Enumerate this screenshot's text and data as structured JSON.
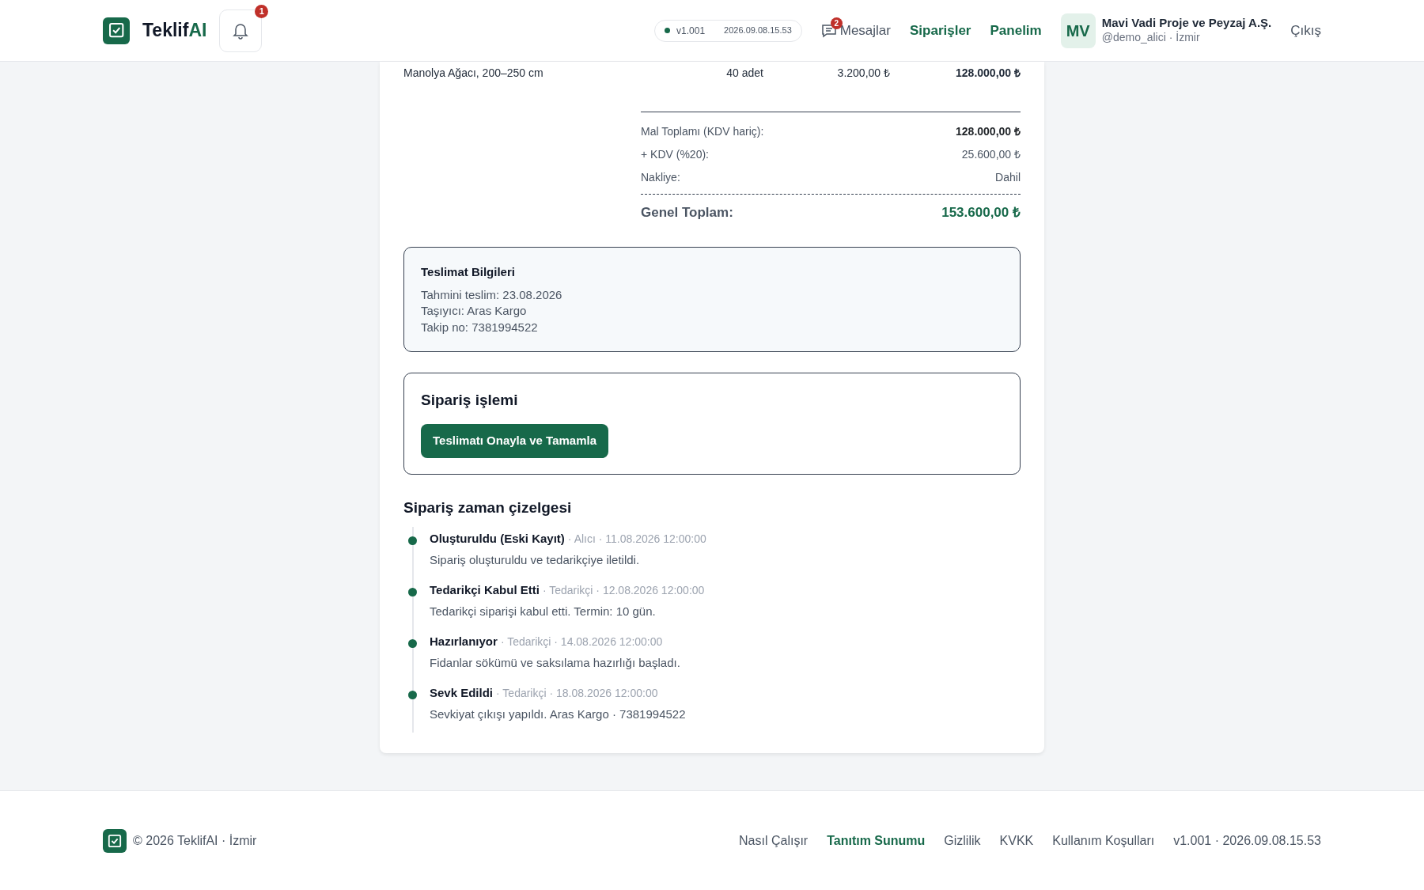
{
  "header": {
    "brand": {
      "name": "Teklif",
      "accent": "AI"
    },
    "notifications": {
      "count": "1"
    },
    "version": {
      "number": "v1.001",
      "build": "2026.09.08.15.53"
    },
    "nav": [
      {
        "label": "Mesajlar",
        "badge": "2",
        "kind": "messages"
      },
      {
        "label": "Siparişler",
        "kind": "primary"
      },
      {
        "label": "Panelim",
        "kind": "primary"
      }
    ],
    "user": {
      "initials": "MV",
      "name": "Mavi Vadi Proje ve Peyzaj A.Ş.",
      "handle": "@demo_alici · İzmir"
    },
    "logout": "Çıkış"
  },
  "order_line": {
    "product": "Manolya Ağacı, 200–250 cm",
    "quantity": "40 adet",
    "unit_price": "3.200,00 ₺",
    "total": "128.000,00 ₺"
  },
  "totals": {
    "rows": [
      {
        "label": "Mal Toplamı (KDV hariç):",
        "value": "128.000,00 ₺",
        "kind": "bold"
      },
      {
        "label": "+ KDV (%20):",
        "value": "25.600,00 ₺",
        "kind": "plain"
      },
      {
        "label": "Nakliye:",
        "value": "Dahil",
        "kind": "plain"
      }
    ],
    "grand_total": {
      "label": "Genel Toplam:",
      "value": "153.600,00 ₺"
    }
  },
  "delivery": {
    "title": "Teslimat Bilgileri",
    "lines": [
      "Tahmini teslim: 23.08.2026",
      "Taşıyıcı: Aras Kargo",
      "Takip no: 7381994522"
    ]
  },
  "action": {
    "title": "Sipariş işlemi",
    "button": "Teslimatı Onayla ve Tamamla"
  },
  "timeline": {
    "title": "Sipariş zaman çizelgesi",
    "events": [
      {
        "status": "Oluşturuldu (Eski Kayıt)",
        "meta": "· Alıcı · 11.08.2026 12:00:00",
        "note": "Sipariş oluşturuldu ve tedarikçiye iletildi."
      },
      {
        "status": "Tedarikçi Kabul Etti",
        "meta": "· Tedarikçi · 12.08.2026 12:00:00",
        "note": "Tedarikçi siparişi kabul etti. Termin: 10 gün."
      },
      {
        "status": "Hazırlanıyor",
        "meta": "· Tedarikçi · 14.08.2026 12:00:00",
        "note": "Fidanlar sökümü ve saksılama hazırlığı başladı."
      },
      {
        "status": "Sevk Edildi",
        "meta": "· Tedarikçi · 18.08.2026 12:00:00",
        "note": "Sevkiyat çıkışı yapıldı. Aras Kargo · 7381994522"
      }
    ]
  },
  "footer": {
    "copyright": "© 2026 TeklifAI · İzmir",
    "links": [
      {
        "label": "Nasıl Çalışır",
        "selected": false
      },
      {
        "label": "Tanıtım Sunumu",
        "selected": true
      },
      {
        "label": "Gizlilik",
        "selected": false
      },
      {
        "label": "KVKK",
        "selected": false
      },
      {
        "label": "Kullanım Koşulları",
        "selected": false
      }
    ],
    "version": "v1.001 · 2026.09.08.15.53"
  }
}
